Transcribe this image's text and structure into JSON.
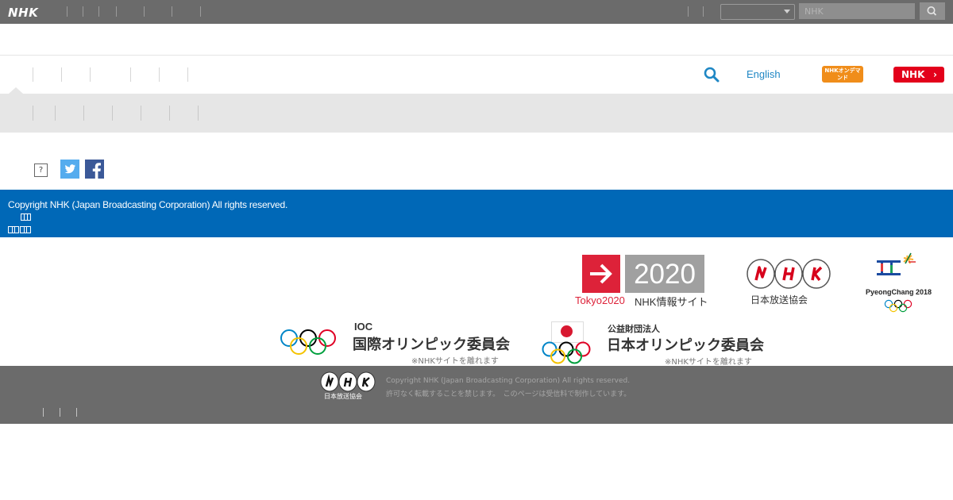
{
  "header": {
    "logo": "NHK",
    "search_placeholder": "NHK",
    "select_value": ""
  },
  "nav": {
    "english_label": "English",
    "ondemand_label": "NHKオンデマンド",
    "nhk_button_label": "NHK"
  },
  "footer_band": {
    "copyright": "Copyright NHK (Japan Broadcasting Corporation) All rights reserved."
  },
  "sponsors": {
    "tokyo": {
      "year": "2020",
      "red_label": "Tokyo2020",
      "info_label": "NHK情報サイト"
    },
    "nhk_logo_caption": "日本放送協会",
    "pyeongchang_caption": "PyeongChang 2018",
    "ioc": {
      "small": "IOC",
      "name": "国際オリンピック委員会",
      "note": "※NHKサイトを離れます"
    },
    "joc": {
      "small": "公益財団法人",
      "name": "日本オリンピック委員会",
      "note": "※NHKサイトを離れます"
    }
  },
  "footer": {
    "logo_caption": "日本放送協会",
    "copyright": "Copyright NHK (Japan Broadcasting Corporation) All rights reserved.",
    "notice": "許可なく転載することを禁じます。　このページは受信料で制作しています。"
  },
  "colors": {
    "topbar": "#6b6b6b",
    "band": "#0068b7",
    "nhk_red": "#e3001b",
    "ondemand_orange": "#f08d1a",
    "tokyo_red": "#dd2239"
  },
  "icons": [
    "search-icon",
    "twitter-icon",
    "facebook-icon",
    "help-icon",
    "chevron-right-icon",
    "olympic-rings-icon"
  ]
}
